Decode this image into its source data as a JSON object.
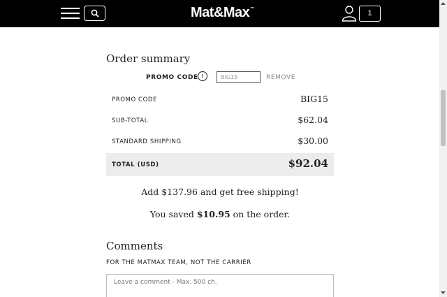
{
  "header": {
    "logo": "Mat&Max",
    "logo_mark": "™",
    "cart_count": "1",
    "icons": {
      "menu": "hamburger-icon",
      "search": "search-icon",
      "user": "user-icon"
    }
  },
  "order_summary": {
    "title": "Order summary",
    "promo": {
      "label": "PROMO CODE",
      "info": "i",
      "value": "BIG15",
      "remove_label": "REMOVE"
    },
    "rows": [
      {
        "label": "PROMO CODE",
        "value": "BIG15"
      },
      {
        "label": "SUB-TOTAL",
        "value": "$62.04"
      },
      {
        "label": "STANDARD SHIPPING",
        "value": "$30.00"
      }
    ],
    "total": {
      "label": "TOTAL (USD)",
      "value": "$92.04"
    },
    "free_shipping": {
      "prefix": "Add ",
      "amount": "$137.96",
      "suffix": " and get free shipping!"
    },
    "savings": {
      "prefix": "You saved ",
      "amount": "$10.95",
      "suffix": " on the order."
    }
  },
  "comments": {
    "title": "Comments",
    "subtitle": "FOR THE MATMAX TEAM, NOT THE CARRIER",
    "placeholder": "Leave a comment - Max. 500 ch."
  },
  "colors": {
    "header_bg": "#000000",
    "total_row_bg": "#ececec",
    "muted": "#8a8a8a"
  }
}
